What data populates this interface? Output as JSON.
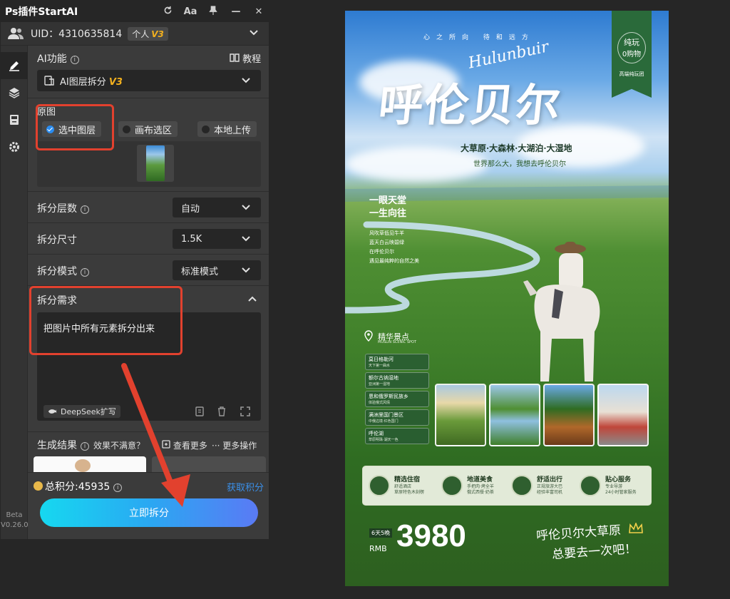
{
  "window": {
    "title": "Ps插件StartAI",
    "buttons": [
      "refresh",
      "font-size",
      "pin",
      "minimize",
      "close"
    ],
    "font_btn": "Aa",
    "min_btn": "—",
    "close_btn": "✕"
  },
  "user": {
    "uid": "UID：4310635814",
    "plan": "个人",
    "plan_version": "V3"
  },
  "sidebar": {
    "items": [
      "edit-icon",
      "layers-icon",
      "save-icon",
      "settings-icon"
    ],
    "version_label": "Beta",
    "version": "V0.26.0"
  },
  "feature": {
    "label": "AI功能",
    "tutorial_label": "教程",
    "selected": "AI图层拆分",
    "selected_version": "V3"
  },
  "source": {
    "label": "原图",
    "options": [
      {
        "label": "选中图层",
        "selected": true
      },
      {
        "label": "画布选区",
        "selected": false
      },
      {
        "label": "本地上传",
        "selected": false
      }
    ]
  },
  "settings": [
    {
      "label": "拆分层数",
      "value": "自动",
      "has_info": true
    },
    {
      "label": "拆分尺寸",
      "value": "1.5K",
      "has_info": false
    },
    {
      "label": "拆分模式",
      "value": "标准模式",
      "has_info": true
    }
  ],
  "requirement": {
    "label": "拆分需求",
    "text": "把图片中所有元素拆分出来",
    "deepseek_label": "DeepSeek扩写"
  },
  "results": {
    "label": "生成结果",
    "feedback": "效果不满意？",
    "view_more": "查看更多",
    "more_actions": "··· 更多操作"
  },
  "footer": {
    "points": "总积分:45935",
    "earn_label": "获取积分",
    "submit_label": "立即拆分"
  },
  "colors": {
    "accent_blue": "#2a8cf0",
    "annotation_red": "#e2412e",
    "button_gradient_start": "#16d8f0",
    "button_gradient_end": "#5a7af4",
    "plan_gold": "#f2b01e"
  },
  "poster": {
    "tagline": "心之所向 待和远方",
    "script_title": "Hulunbuir",
    "title": "呼伦贝尔",
    "badge_l1": "纯玩",
    "badge_l2": "0购物",
    "badge_l3": "高端纯玩团",
    "features": "大草原·大森林·大湖泊·大湿地",
    "slogan": "世界那么大，我想去呼伦贝尔",
    "side_heading": [
      "一眼天堂",
      "一生向往"
    ],
    "side_lines": [
      "风吹草低见牛羊",
      "蓝天白云映碧绿",
      "在呼伦贝尔",
      "遇见最纯粹的自然之美"
    ],
    "spots_title": "精华景点",
    "spots_subtitle": "MUSLIN SCENIC SPOT",
    "spots": [
      {
        "name": "莫日格勒河",
        "desc": "天下第一曲水"
      },
      {
        "name": "额尔古纳湿地",
        "desc": "亚洲第一湿地"
      },
      {
        "name": "恩和俄罗斯民族乡",
        "desc": "体验俄式风情"
      },
      {
        "name": "满洲里国门景区",
        "desc": "中俄边境·红色国门"
      },
      {
        "name": "呼伦湖",
        "desc": "草原明珠·湖天一色"
      }
    ],
    "services": [
      {
        "name": "精选住宿",
        "desc": [
          "舒适酒店",
          "草原特色木刻楞"
        ]
      },
      {
        "name": "地道美食",
        "desc": [
          "手把肉·烤全羊",
          "俄式西餐·奶茶"
        ]
      },
      {
        "name": "舒适出行",
        "desc": [
          "正规旅游大巴",
          "经验丰富司机"
        ]
      },
      {
        "name": "贴心服务",
        "desc": [
          "专业导游",
          "24小时管家服务"
        ]
      }
    ],
    "price_days": "6天5晚",
    "currency": "RMB",
    "price": "3980",
    "cta_line1": "呼伦贝尔大草原",
    "cta_line2": "总要去一次吧！"
  }
}
